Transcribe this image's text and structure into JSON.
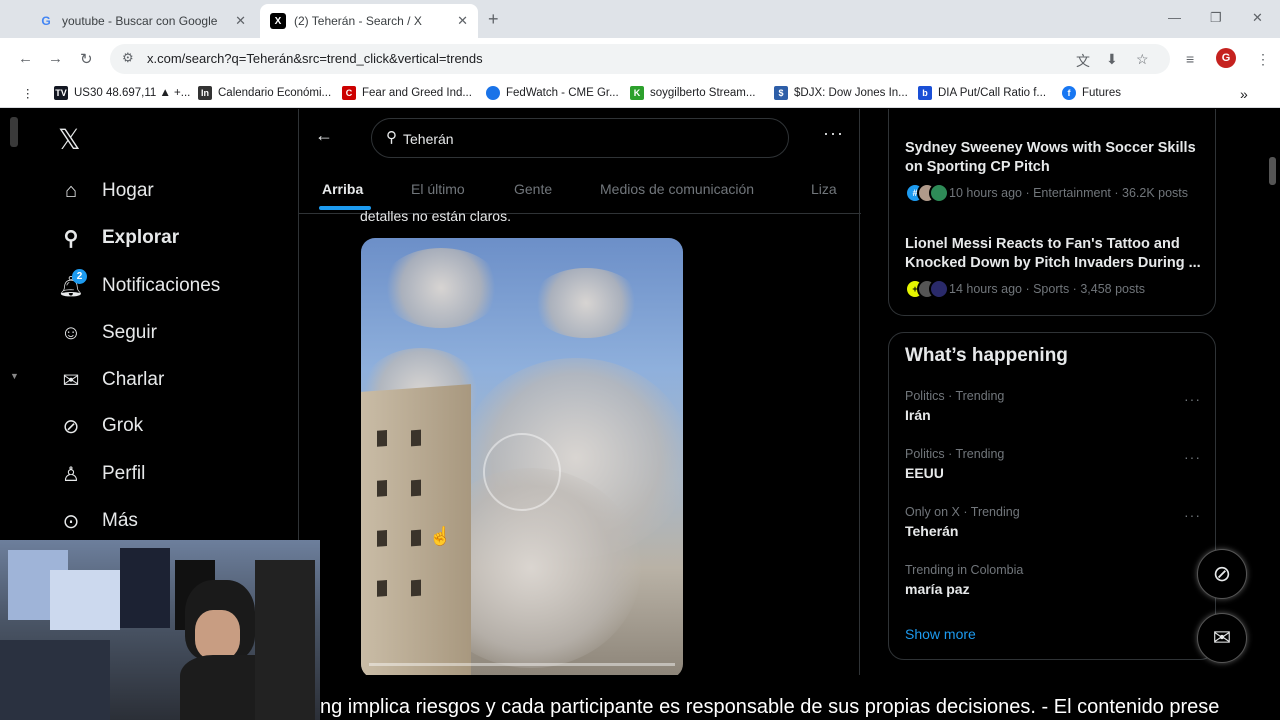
{
  "browser": {
    "tabs": [
      {
        "title": "youtube - Buscar con Google",
        "favicon": "G"
      },
      {
        "title": "(2) Teherán - Search / X",
        "favicon": "X"
      }
    ],
    "url": "x.com/search?q=Teherán&src=trend_click&vertical=trends",
    "profile_initial": "G",
    "bookmarks": [
      {
        "label": "US30 48.697,11 ▲ +...",
        "icon": "TV",
        "color": "#131722"
      },
      {
        "label": "Calendario Económi...",
        "icon": "Inv",
        "color": "#333"
      },
      {
        "label": "Fear and Greed Ind...",
        "icon": "CNN",
        "color": "#cc0000"
      },
      {
        "label": "FedWatch - CME Gr...",
        "icon": "◍",
        "color": "#1a73e8"
      },
      {
        "label": "soygilberto Stream...",
        "icon": "K",
        "color": "#2ca02c"
      },
      {
        "label": "$DJX: Dow Jones In...",
        "icon": "▮▮",
        "color": "#2d5ea8"
      },
      {
        "label": "DIA Put/Call Ratio f...",
        "icon": "b",
        "color": "#1a4fd6"
      },
      {
        "label": "Futures",
        "icon": "f",
        "color": "#1877f2"
      }
    ]
  },
  "x": {
    "logo": "𝕏",
    "nav": [
      {
        "label": "Hogar",
        "icon": "home-icon"
      },
      {
        "label": "Explorar",
        "icon": "search-icon"
      },
      {
        "label": "Notificaciones",
        "icon": "bell-icon",
        "badge": "2"
      },
      {
        "label": "Seguir",
        "icon": "follow-icon"
      },
      {
        "label": "Charlar",
        "icon": "mail-icon"
      },
      {
        "label": "Grok",
        "icon": "grok-icon"
      },
      {
        "label": "Perfil",
        "icon": "person-icon"
      },
      {
        "label": "Más",
        "icon": "more-icon"
      }
    ],
    "search_value": "Teherán",
    "tabs": [
      "Arriba",
      "El último",
      "Gente",
      "Medios de comunicación",
      "Liza"
    ],
    "post_text": "detalles no están claros.",
    "trending_top": [
      {
        "title": "Sydney Sweeney Wows with Soccer Skills on Sporting CP Pitch",
        "meta": "10 hours ago · Entertainment · 36.2K posts"
      },
      {
        "title": "Lionel Messi Reacts to Fan's Tattoo and Knocked Down by Pitch Invaders During ...",
        "meta": "14 hours ago · Sports · 3,458 posts"
      }
    ],
    "whats_happening": {
      "title": "What’s happening",
      "items": [
        {
          "category": "Politics · Trending",
          "name": "Irán"
        },
        {
          "category": "Politics · Trending",
          "name": "EEUU"
        },
        {
          "category": "Only on X · Trending",
          "name": "Teherán"
        },
        {
          "category": "Trending in Colombia",
          "name": "maría paz"
        }
      ],
      "show_more": "Show more"
    }
  },
  "overlay": {
    "subtitle": "ng implica riesgos y cada participante es responsable de sus propias decisiones.  - El contenido prese"
  }
}
